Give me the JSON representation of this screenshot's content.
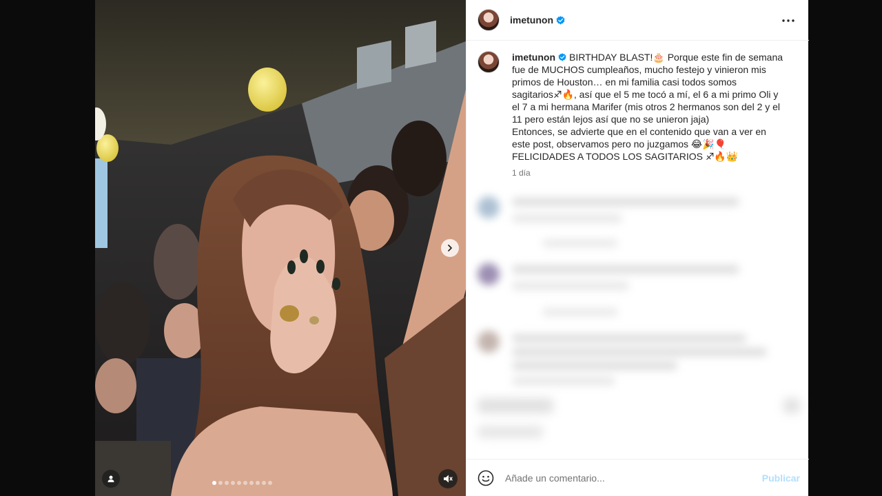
{
  "post": {
    "username": "imetunon",
    "verified": true,
    "caption": {
      "username": "imetunon",
      "lines": [
        "BIRTHDAY BLAST!🎂 Porque este fin de semana",
        "fue de MUCHOS cumpleaños, mucho festejo y vinieron mis",
        "primos de Houston… en mi familia casi todos somos",
        "sagitarios♐🔥, así que el 5 me tocó a mí, el 6 a mi primo Oli y",
        "el 7 a mi hermana Marifer (mis otros 2 hermanos son del 2 y el",
        "11 pero están lejos así que no se unieron jaja)",
        "Entonces, se advierte que en el contenido que van a ver en",
        "este post, observamos pero no juzgamos 😂🎉🎈",
        "FELICIDADES A TODOS LOS SAGITARIOS ♐🔥👑"
      ],
      "time_ago": "1 día"
    }
  },
  "media": {
    "carousel_count": 10,
    "carousel_active_index": 0,
    "icons": {
      "next": "chevron-right-icon",
      "user_tag": "user-icon",
      "mute": "speaker-muted-icon"
    }
  },
  "comment_box": {
    "placeholder": "Añade un comentario...",
    "publish_label": "Publicar"
  },
  "colors": {
    "verified_blue": "#0095f6",
    "publish_disabled": "#b2dffc"
  }
}
